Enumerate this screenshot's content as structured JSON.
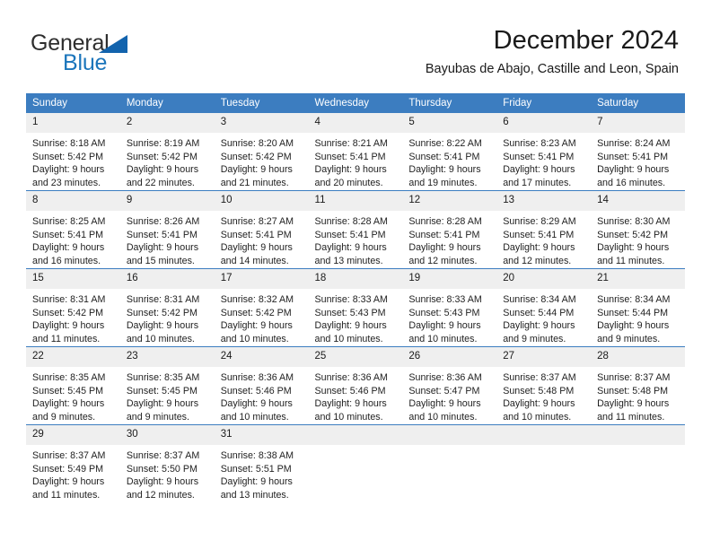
{
  "brand": {
    "name_primary": "General",
    "name_secondary": "Blue",
    "accent_color": "#1b75bb",
    "triangle_color": "#1263ad"
  },
  "header": {
    "title": "December 2024",
    "subtitle": "Bayubas de Abajo, Castille and Leon, Spain"
  },
  "calendar": {
    "header_bg": "#3c7dc0",
    "header_text_color": "#ffffff",
    "daynum_bg": "#efefef",
    "weekday_headers": [
      "Sunday",
      "Monday",
      "Tuesday",
      "Wednesday",
      "Thursday",
      "Friday",
      "Saturday"
    ],
    "weeks": [
      [
        {
          "day": "1",
          "sunrise": "Sunrise: 8:18 AM",
          "sunset": "Sunset: 5:42 PM",
          "daylight_line1": "Daylight: 9 hours",
          "daylight_line2": "and 23 minutes."
        },
        {
          "day": "2",
          "sunrise": "Sunrise: 8:19 AM",
          "sunset": "Sunset: 5:42 PM",
          "daylight_line1": "Daylight: 9 hours",
          "daylight_line2": "and 22 minutes."
        },
        {
          "day": "3",
          "sunrise": "Sunrise: 8:20 AM",
          "sunset": "Sunset: 5:42 PM",
          "daylight_line1": "Daylight: 9 hours",
          "daylight_line2": "and 21 minutes."
        },
        {
          "day": "4",
          "sunrise": "Sunrise: 8:21 AM",
          "sunset": "Sunset: 5:41 PM",
          "daylight_line1": "Daylight: 9 hours",
          "daylight_line2": "and 20 minutes."
        },
        {
          "day": "5",
          "sunrise": "Sunrise: 8:22 AM",
          "sunset": "Sunset: 5:41 PM",
          "daylight_line1": "Daylight: 9 hours",
          "daylight_line2": "and 19 minutes."
        },
        {
          "day": "6",
          "sunrise": "Sunrise: 8:23 AM",
          "sunset": "Sunset: 5:41 PM",
          "daylight_line1": "Daylight: 9 hours",
          "daylight_line2": "and 17 minutes."
        },
        {
          "day": "7",
          "sunrise": "Sunrise: 8:24 AM",
          "sunset": "Sunset: 5:41 PM",
          "daylight_line1": "Daylight: 9 hours",
          "daylight_line2": "and 16 minutes."
        }
      ],
      [
        {
          "day": "8",
          "sunrise": "Sunrise: 8:25 AM",
          "sunset": "Sunset: 5:41 PM",
          "daylight_line1": "Daylight: 9 hours",
          "daylight_line2": "and 16 minutes."
        },
        {
          "day": "9",
          "sunrise": "Sunrise: 8:26 AM",
          "sunset": "Sunset: 5:41 PM",
          "daylight_line1": "Daylight: 9 hours",
          "daylight_line2": "and 15 minutes."
        },
        {
          "day": "10",
          "sunrise": "Sunrise: 8:27 AM",
          "sunset": "Sunset: 5:41 PM",
          "daylight_line1": "Daylight: 9 hours",
          "daylight_line2": "and 14 minutes."
        },
        {
          "day": "11",
          "sunrise": "Sunrise: 8:28 AM",
          "sunset": "Sunset: 5:41 PM",
          "daylight_line1": "Daylight: 9 hours",
          "daylight_line2": "and 13 minutes."
        },
        {
          "day": "12",
          "sunrise": "Sunrise: 8:28 AM",
          "sunset": "Sunset: 5:41 PM",
          "daylight_line1": "Daylight: 9 hours",
          "daylight_line2": "and 12 minutes."
        },
        {
          "day": "13",
          "sunrise": "Sunrise: 8:29 AM",
          "sunset": "Sunset: 5:41 PM",
          "daylight_line1": "Daylight: 9 hours",
          "daylight_line2": "and 12 minutes."
        },
        {
          "day": "14",
          "sunrise": "Sunrise: 8:30 AM",
          "sunset": "Sunset: 5:42 PM",
          "daylight_line1": "Daylight: 9 hours",
          "daylight_line2": "and 11 minutes."
        }
      ],
      [
        {
          "day": "15",
          "sunrise": "Sunrise: 8:31 AM",
          "sunset": "Sunset: 5:42 PM",
          "daylight_line1": "Daylight: 9 hours",
          "daylight_line2": "and 11 minutes."
        },
        {
          "day": "16",
          "sunrise": "Sunrise: 8:31 AM",
          "sunset": "Sunset: 5:42 PM",
          "daylight_line1": "Daylight: 9 hours",
          "daylight_line2": "and 10 minutes."
        },
        {
          "day": "17",
          "sunrise": "Sunrise: 8:32 AM",
          "sunset": "Sunset: 5:42 PM",
          "daylight_line1": "Daylight: 9 hours",
          "daylight_line2": "and 10 minutes."
        },
        {
          "day": "18",
          "sunrise": "Sunrise: 8:33 AM",
          "sunset": "Sunset: 5:43 PM",
          "daylight_line1": "Daylight: 9 hours",
          "daylight_line2": "and 10 minutes."
        },
        {
          "day": "19",
          "sunrise": "Sunrise: 8:33 AM",
          "sunset": "Sunset: 5:43 PM",
          "daylight_line1": "Daylight: 9 hours",
          "daylight_line2": "and 10 minutes."
        },
        {
          "day": "20",
          "sunrise": "Sunrise: 8:34 AM",
          "sunset": "Sunset: 5:44 PM",
          "daylight_line1": "Daylight: 9 hours",
          "daylight_line2": "and 9 minutes."
        },
        {
          "day": "21",
          "sunrise": "Sunrise: 8:34 AM",
          "sunset": "Sunset: 5:44 PM",
          "daylight_line1": "Daylight: 9 hours",
          "daylight_line2": "and 9 minutes."
        }
      ],
      [
        {
          "day": "22",
          "sunrise": "Sunrise: 8:35 AM",
          "sunset": "Sunset: 5:45 PM",
          "daylight_line1": "Daylight: 9 hours",
          "daylight_line2": "and 9 minutes."
        },
        {
          "day": "23",
          "sunrise": "Sunrise: 8:35 AM",
          "sunset": "Sunset: 5:45 PM",
          "daylight_line1": "Daylight: 9 hours",
          "daylight_line2": "and 9 minutes."
        },
        {
          "day": "24",
          "sunrise": "Sunrise: 8:36 AM",
          "sunset": "Sunset: 5:46 PM",
          "daylight_line1": "Daylight: 9 hours",
          "daylight_line2": "and 10 minutes."
        },
        {
          "day": "25",
          "sunrise": "Sunrise: 8:36 AM",
          "sunset": "Sunset: 5:46 PM",
          "daylight_line1": "Daylight: 9 hours",
          "daylight_line2": "and 10 minutes."
        },
        {
          "day": "26",
          "sunrise": "Sunrise: 8:36 AM",
          "sunset": "Sunset: 5:47 PM",
          "daylight_line1": "Daylight: 9 hours",
          "daylight_line2": "and 10 minutes."
        },
        {
          "day": "27",
          "sunrise": "Sunrise: 8:37 AM",
          "sunset": "Sunset: 5:48 PM",
          "daylight_line1": "Daylight: 9 hours",
          "daylight_line2": "and 10 minutes."
        },
        {
          "day": "28",
          "sunrise": "Sunrise: 8:37 AM",
          "sunset": "Sunset: 5:48 PM",
          "daylight_line1": "Daylight: 9 hours",
          "daylight_line2": "and 11 minutes."
        }
      ],
      [
        {
          "day": "29",
          "sunrise": "Sunrise: 8:37 AM",
          "sunset": "Sunset: 5:49 PM",
          "daylight_line1": "Daylight: 9 hours",
          "daylight_line2": "and 11 minutes."
        },
        {
          "day": "30",
          "sunrise": "Sunrise: 8:37 AM",
          "sunset": "Sunset: 5:50 PM",
          "daylight_line1": "Daylight: 9 hours",
          "daylight_line2": "and 12 minutes."
        },
        {
          "day": "31",
          "sunrise": "Sunrise: 8:38 AM",
          "sunset": "Sunset: 5:51 PM",
          "daylight_line1": "Daylight: 9 hours",
          "daylight_line2": "and 13 minutes."
        },
        {
          "day": "",
          "sunrise": "",
          "sunset": "",
          "daylight_line1": "",
          "daylight_line2": ""
        },
        {
          "day": "",
          "sunrise": "",
          "sunset": "",
          "daylight_line1": "",
          "daylight_line2": ""
        },
        {
          "day": "",
          "sunrise": "",
          "sunset": "",
          "daylight_line1": "",
          "daylight_line2": ""
        },
        {
          "day": "",
          "sunrise": "",
          "sunset": "",
          "daylight_line1": "",
          "daylight_line2": ""
        }
      ]
    ]
  }
}
